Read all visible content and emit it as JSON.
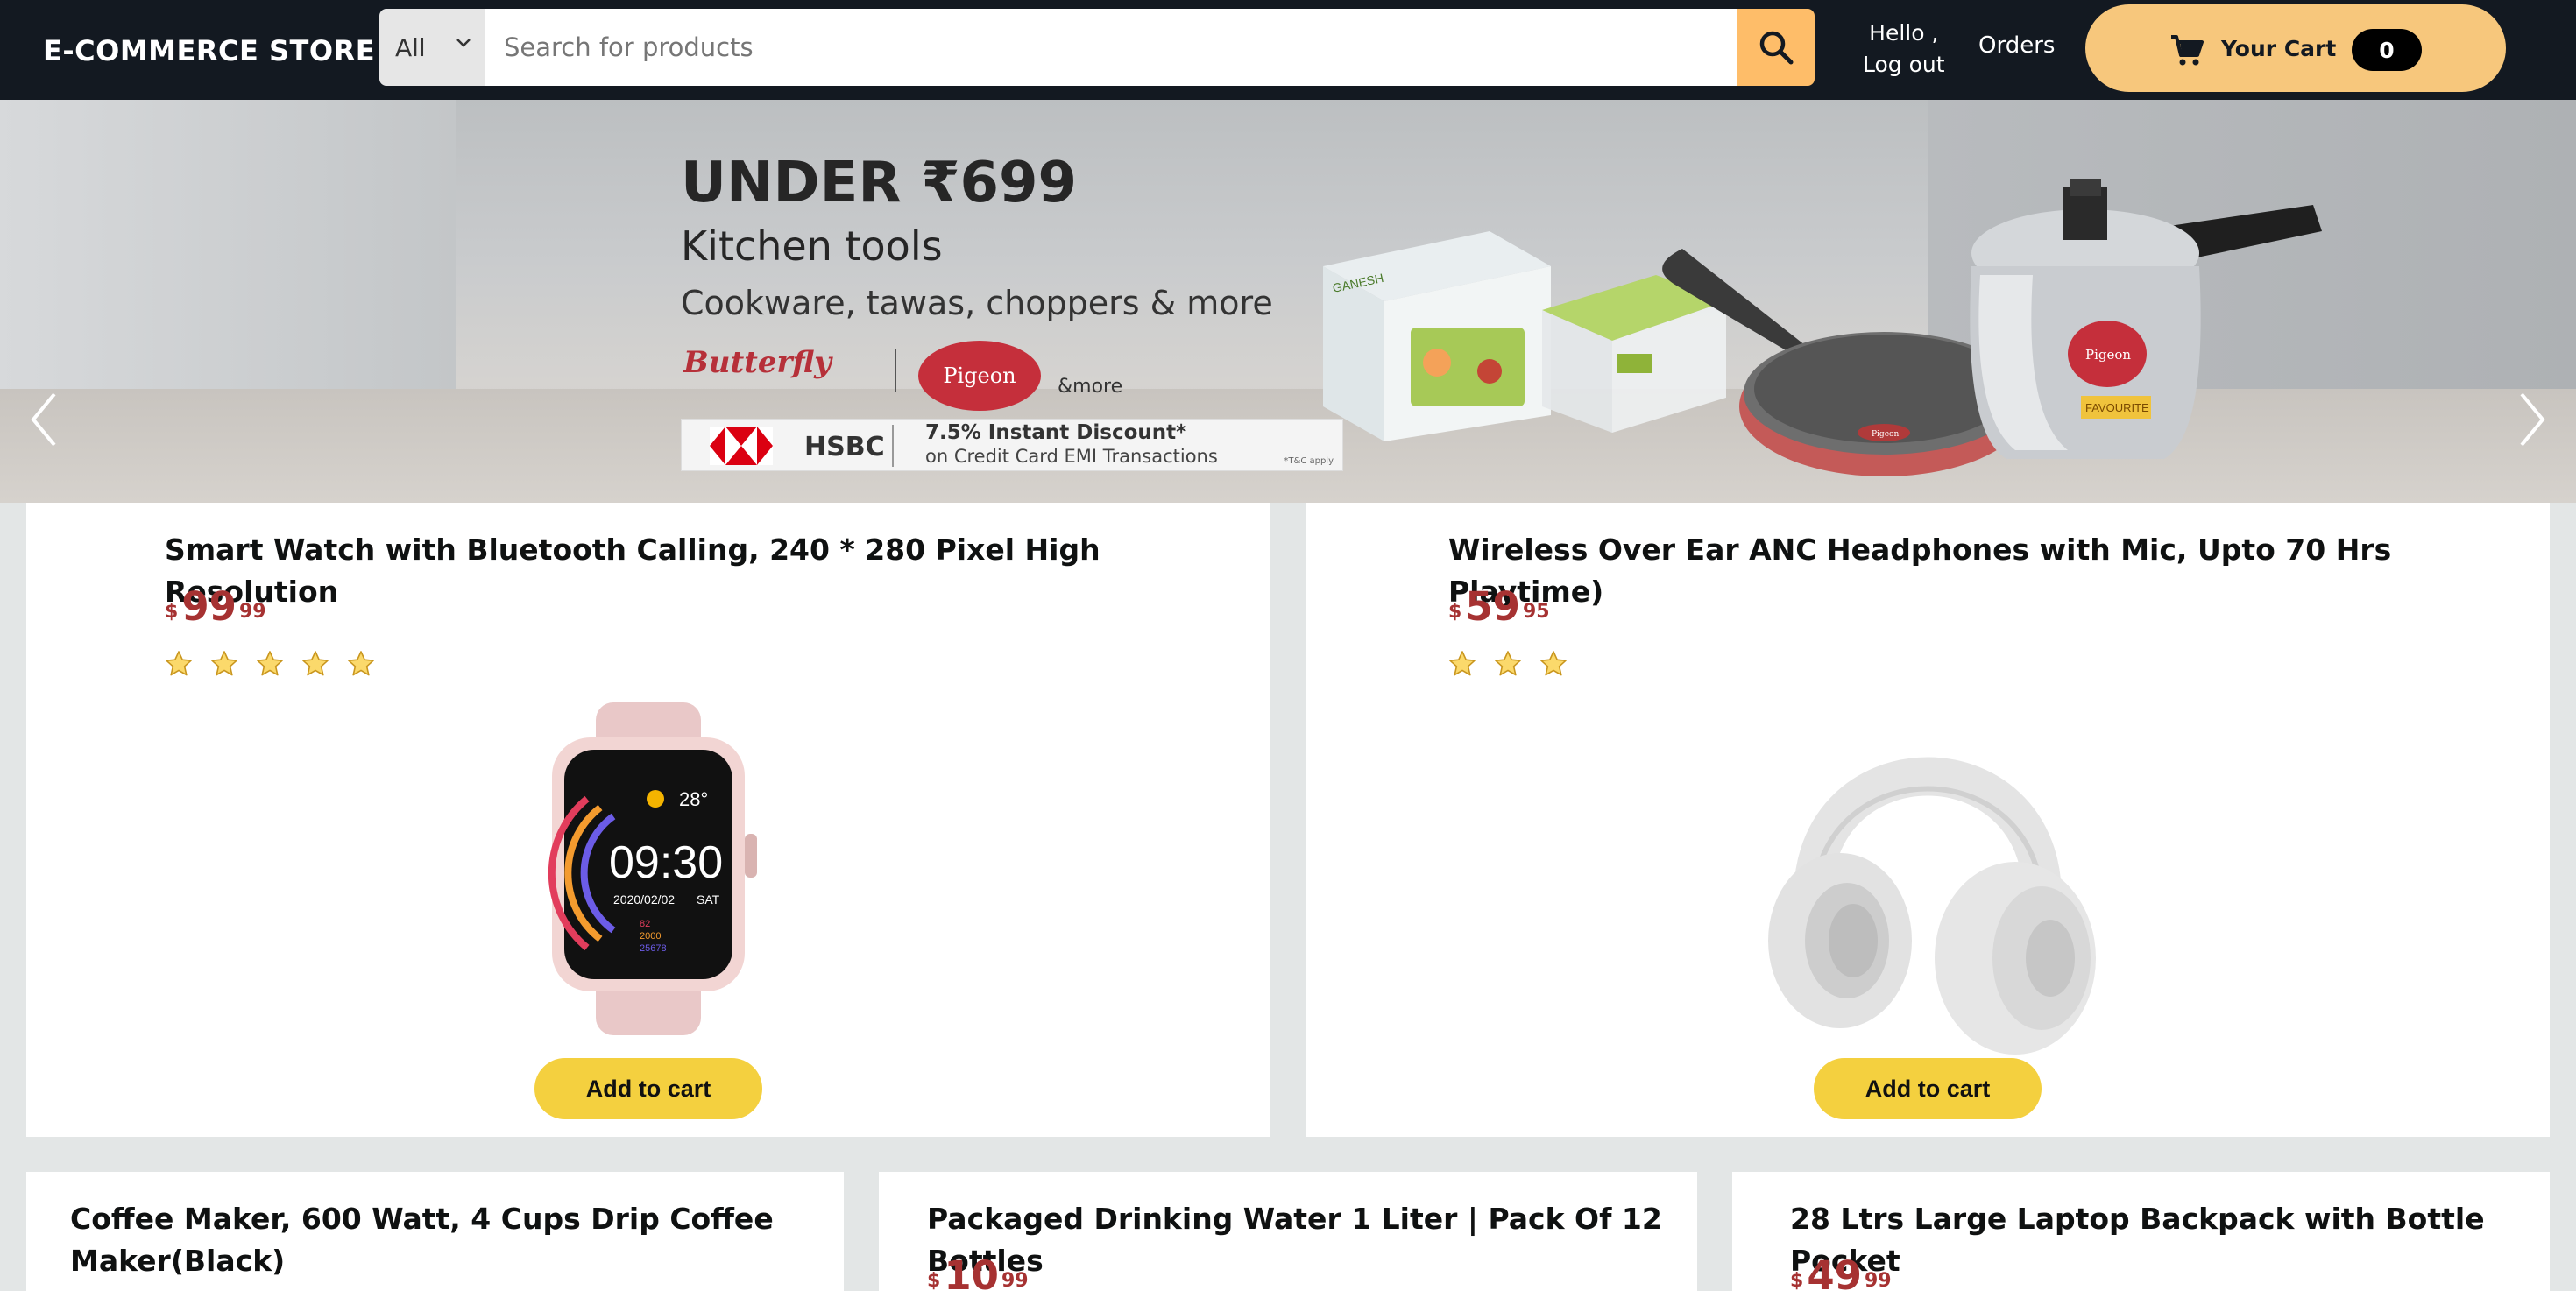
{
  "header": {
    "logo": "E-COMMERCE STORE",
    "search_category": "All",
    "search_placeholder": "Search for products",
    "greeting_line1": "Hello ,",
    "greeting_line2": "Log out",
    "orders": "Orders",
    "cart_label": "Your Cart",
    "cart_count": "0",
    "accent_color": "#febd69",
    "header_color": "#131921"
  },
  "hero": {
    "title": "UNDER ₹699",
    "subtitle1": "Kitchen tools",
    "subtitle2": "Cookware, tawas, choppers & more",
    "brand1": "Butterfly",
    "brand2": "Pigeon",
    "brand_more": "&more",
    "bank": "HSBC",
    "offer_line1": "7.5% Instant Discount*",
    "offer_line2": "on Credit Card EMI Transactions",
    "terms": "*T&C apply",
    "product_labels": {
      "chopper_box": "GANESH",
      "pan_logo": "Pigeon",
      "cooker_logo": "Pigeon",
      "cooker_tag": "FAVOURITE"
    }
  },
  "products": [
    {
      "title": "Smart Watch with Bluetooth Calling, 240 * 280 Pixel High Resolution",
      "currency": "$",
      "price_whole": "99",
      "price_fraction": "99",
      "rating": 5,
      "button": "Add to cart",
      "image_text": {
        "time": "09:30",
        "date": "2020/02/02",
        "day": "SAT",
        "temperature": "28°",
        "stat1": "82",
        "stat2": "2000",
        "stat3": "25678"
      }
    },
    {
      "title": "Wireless Over Ear ANC Headphones with Mic, Upto 70 Hrs Playtime)",
      "currency": "$",
      "price_whole": "59",
      "price_fraction": "95",
      "rating": 3,
      "button": "Add to cart"
    },
    {
      "title_line1": "Coffee Maker, 600 Watt, 4 Cups Drip Coffee",
      "title_line2": "Maker(Black)"
    },
    {
      "title": "Packaged Drinking Water 1 Liter | Pack Of 12 Bottles",
      "currency": "$",
      "price_whole": "10",
      "price_fraction": "99"
    },
    {
      "title": "28 Ltrs Large Laptop Backpack with Bottle Pocket",
      "currency": "$",
      "price_whole": "49",
      "price_fraction": "99"
    }
  ]
}
